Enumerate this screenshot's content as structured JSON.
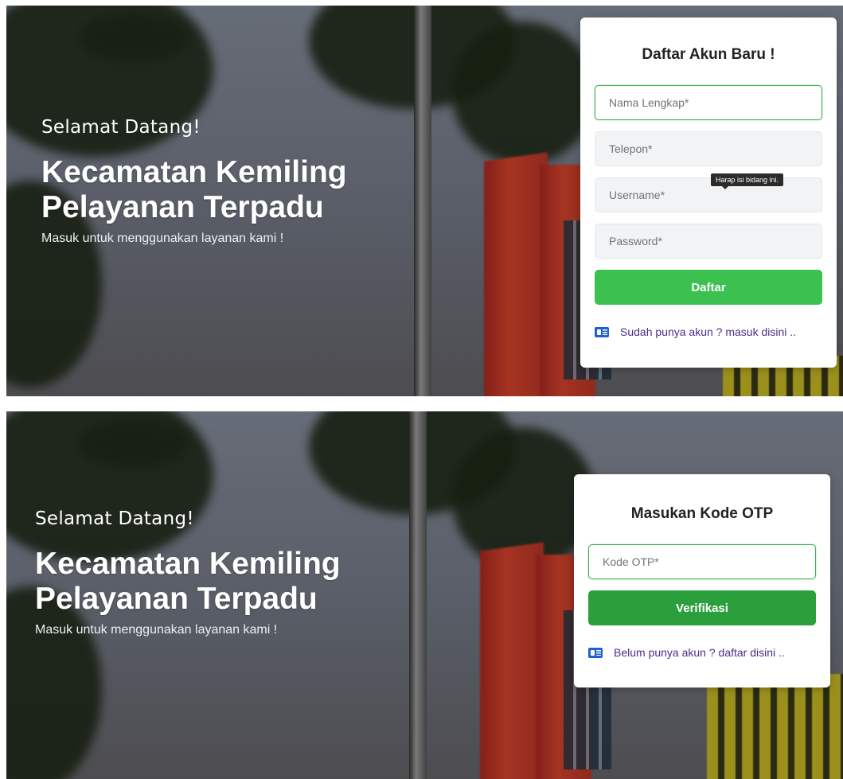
{
  "register": {
    "hero": {
      "welcome": "Selamat Datang!",
      "title_line1": "Kecamatan Kemiling",
      "title_line2": "Pelayanan Terpadu",
      "subtitle": "Masuk untuk menggunakan layanan kami !"
    },
    "form": {
      "title": "Daftar Akun Baru !",
      "fullname_placeholder": "Nama Lengkap*",
      "phone_placeholder": "Telepon*",
      "username_placeholder": "Username*",
      "password_placeholder": "Password*",
      "tooltip": "Harap isi bidang ini.",
      "submit_label": "Daftar",
      "login_link": "Sudah punya akun ? masuk disini .."
    }
  },
  "otp": {
    "hero": {
      "welcome": "Selamat Datang!",
      "title_line1": "Kecamatan Kemiling",
      "title_line2": "Pelayanan Terpadu",
      "subtitle": "Masuk untuk menggunakan layanan kami !"
    },
    "form": {
      "title": "Masukan Kode OTP",
      "otp_placeholder": "Kode OTP*",
      "submit_label": "Verifikasi",
      "register_link": "Belum punya akun ? daftar disini .."
    }
  },
  "colors": {
    "primary_button": "#3cc050",
    "verify_button": "#2a9f3b",
    "focus_border": "#38b24a",
    "link": "#4a2c8a",
    "icon": "#1f5fd1"
  },
  "icons": [
    "id-card-icon"
  ]
}
